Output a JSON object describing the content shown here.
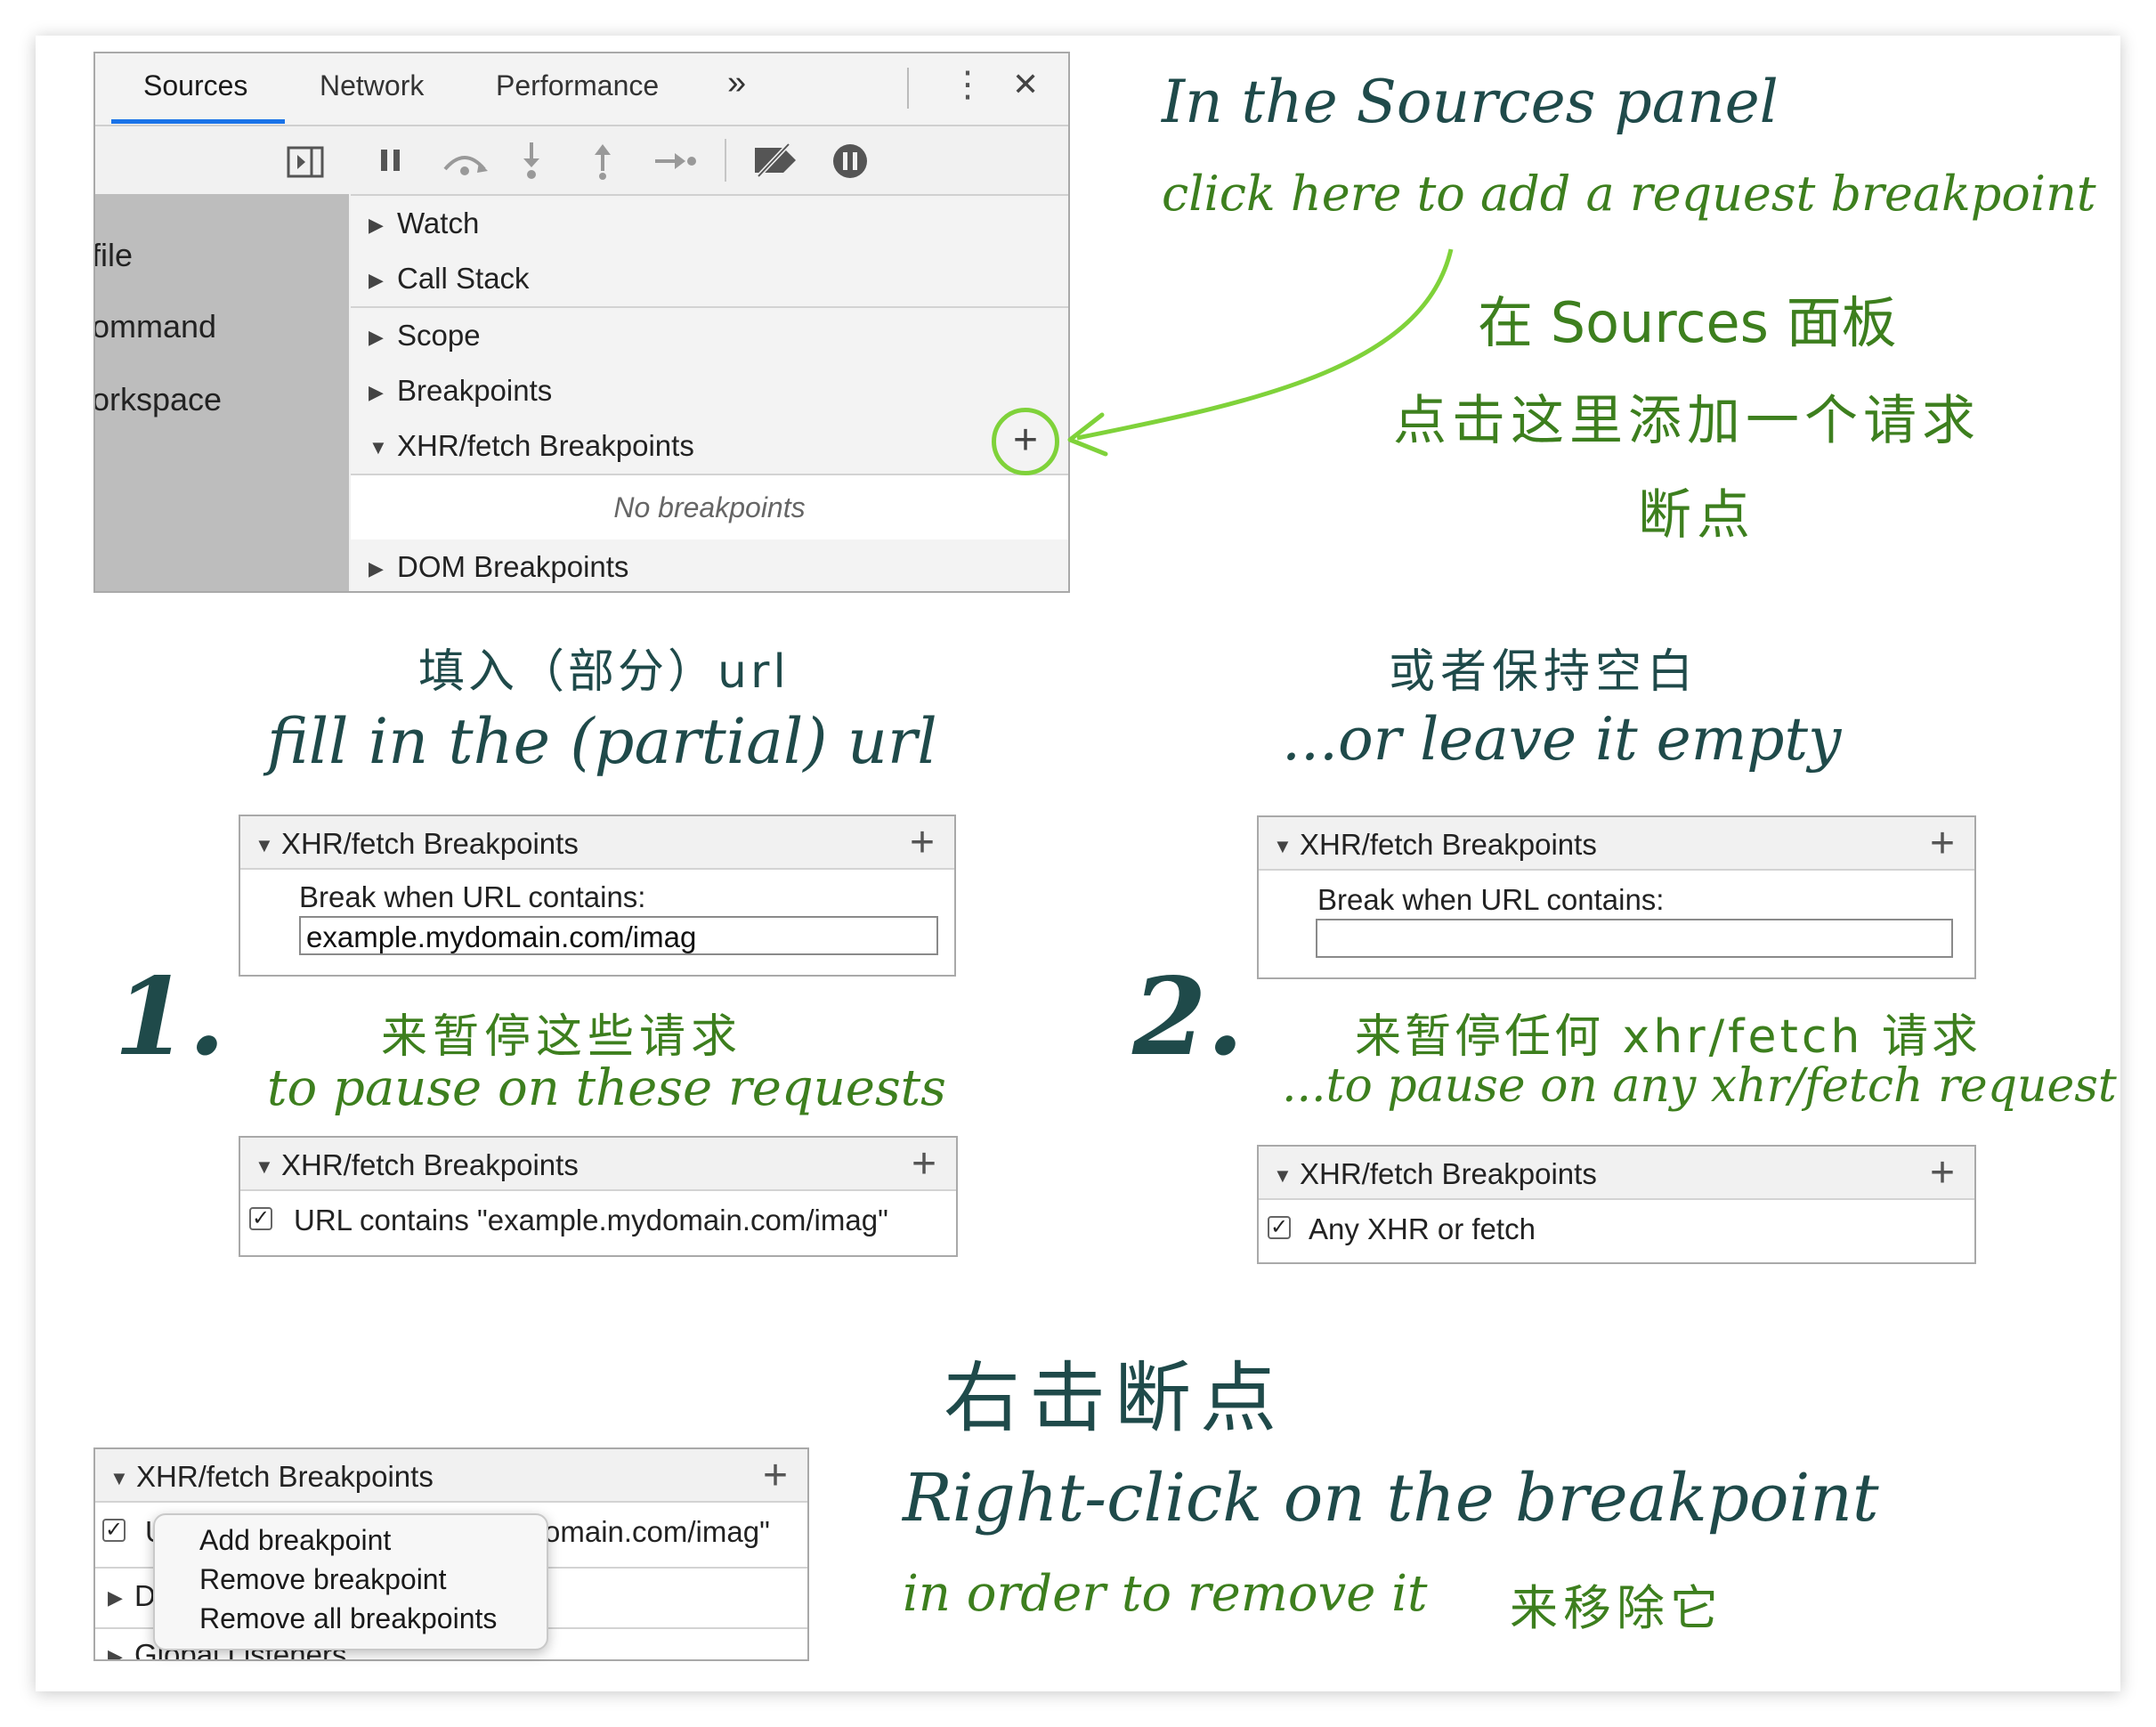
{
  "devtools": {
    "tabs": [
      "Sources",
      "Network",
      "Performance"
    ],
    "more_tabs": "»",
    "menu_icon": "⋮",
    "close_icon": "✕",
    "sidebar_items": [
      "file",
      "ommand",
      "orkspace"
    ],
    "sections": [
      "Watch",
      "Call Stack",
      "Scope",
      "Breakpoints",
      "XHR/fetch Breakpoints",
      "DOM Breakpoints"
    ],
    "no_breakpoints": "No breakpoints",
    "add_button": "+"
  },
  "annotations": {
    "top_en_1": "In the Sources panel",
    "top_en_2": "click here to add a request breakpoint",
    "top_zh_1": "在 Sources 面板",
    "top_zh_2": "点击这里添加一个请求",
    "top_zh_3": "断点",
    "left_zh": "填入（部分）url",
    "left_en": "fill in the (partial) url",
    "right_zh": "或者保持空白",
    "right_en": "...or leave it empty",
    "step1": "1.",
    "step2": "2.",
    "step1_zh": "来暂停这些请求",
    "step1_en": "to pause on these requests",
    "step2_zh": "来暂停任何 xhr/fetch 请求",
    "step2_en": "...to pause on any xhr/fetch request",
    "bottom_zh": "右击断点",
    "bottom_en": "Right-click on the breakpoint",
    "bottom_en_2": "in order to remove it",
    "bottom_zh_2": "来移除它"
  },
  "panel1": {
    "title": "XHR/fetch Breakpoints",
    "label": "Break when URL contains:",
    "input_value": "example.mydomain.com/imag"
  },
  "panel2": {
    "title": "XHR/fetch Breakpoints",
    "label": "Break when URL contains:",
    "input_value": ""
  },
  "panel3": {
    "title": "XHR/fetch Breakpoints",
    "item": "URL contains \"example.mydomain.com/imag\""
  },
  "panel4": {
    "title": "XHR/fetch Breakpoints",
    "item": "Any XHR or fetch"
  },
  "panel5": {
    "title": "XHR/fetch Breakpoints",
    "item_partial": "omain.com/imag\"",
    "row_d": "D",
    "row_global": "Global Listeners",
    "row_u": "U"
  },
  "context_menu": {
    "items": [
      "Add breakpoint",
      "Remove breakpoint",
      "Remove all breakpoints"
    ]
  },
  "colors": {
    "accent_green": "#7fd23a",
    "text_green": "#3d7f1e",
    "text_dark": "#1f4a4a",
    "tab_blue": "#1a73e8"
  }
}
